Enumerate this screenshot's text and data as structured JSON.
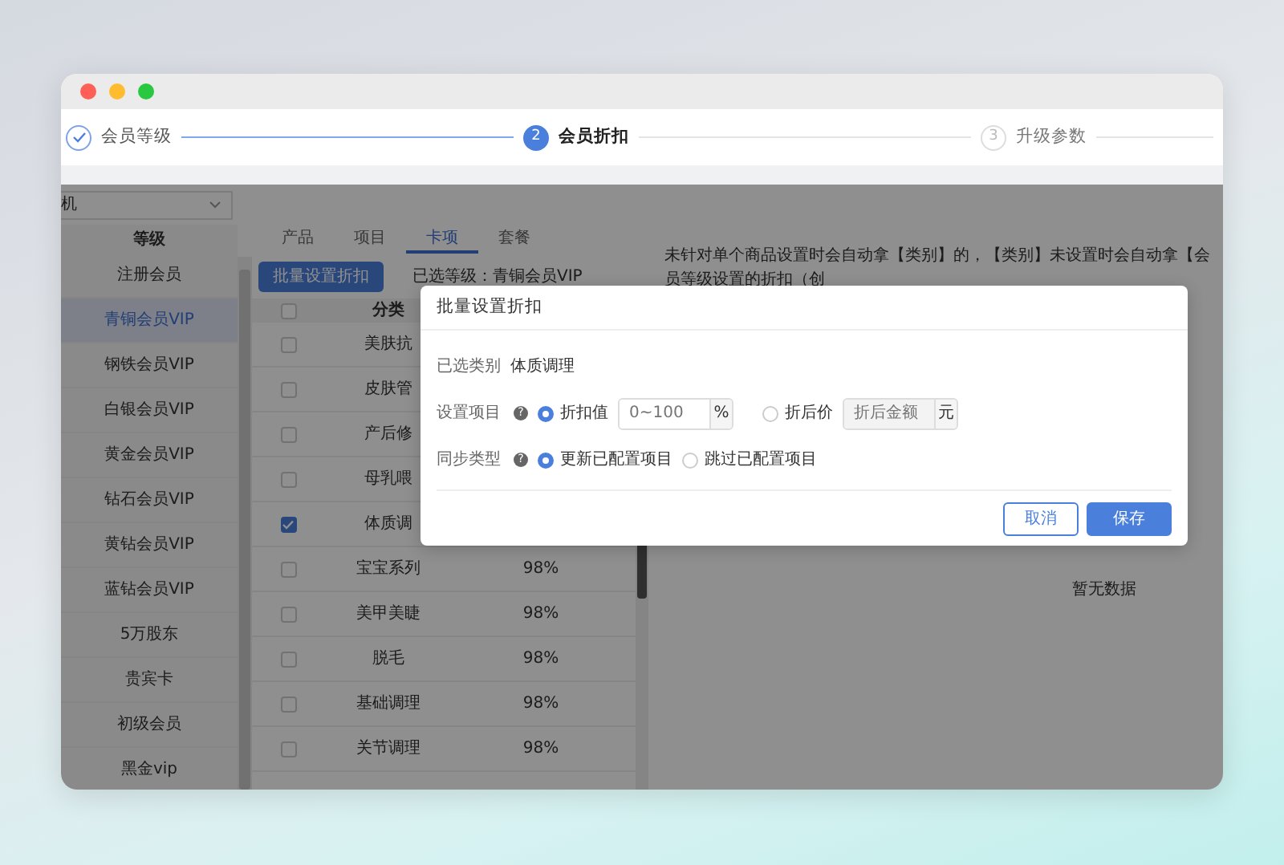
{
  "steps": [
    {
      "label": "会员等级",
      "completed": true,
      "selected": false
    },
    {
      "number": "2",
      "label": "会员折扣",
      "completed": false,
      "selected": true
    },
    {
      "number": "3",
      "label": "升级参数",
      "completed": false,
      "selected": false
    }
  ],
  "level_filter": {
    "value": "机"
  },
  "levels": {
    "header": "等级",
    "items": [
      {
        "label": "注册会员",
        "selected": false
      },
      {
        "label": "青铜会员VIP",
        "selected": true
      },
      {
        "label": "钢铁会员VIP",
        "selected": false
      },
      {
        "label": "白银会员VIP",
        "selected": false
      },
      {
        "label": "黄金会员VIP",
        "selected": false
      },
      {
        "label": "钻石会员VIP",
        "selected": false
      },
      {
        "label": "黄钻会员VIP",
        "selected": false
      },
      {
        "label": "蓝钻会员VIP",
        "selected": false
      },
      {
        "label": "5万股东",
        "selected": false
      },
      {
        "label": "贵宾卡",
        "selected": false
      },
      {
        "label": "初级会员",
        "selected": false
      },
      {
        "label": "黑金vip",
        "selected": false
      }
    ]
  },
  "tabs": [
    {
      "label": "产品",
      "selected": false
    },
    {
      "label": "项目",
      "selected": false
    },
    {
      "label": "卡项",
      "selected": true
    },
    {
      "label": "套餐",
      "selected": false
    }
  ],
  "batch_button": "批量设置折扣",
  "selected_level": "已选等级：青铜会员VIP",
  "table": {
    "header_checked": false,
    "columns": [
      "分类"
    ],
    "rows": [
      {
        "checked": false,
        "category": "美肤抗"
      },
      {
        "checked": false,
        "category": "皮肤管"
      },
      {
        "checked": false,
        "category": "产后修"
      },
      {
        "checked": false,
        "category": "母乳喂"
      },
      {
        "checked": true,
        "category": "体质调"
      },
      {
        "checked": false,
        "category": "宝宝系列",
        "discount": "98%"
      },
      {
        "checked": false,
        "category": "美甲美睫",
        "discount": "98%"
      },
      {
        "checked": false,
        "category": "脱毛",
        "discount": "98%"
      },
      {
        "checked": false,
        "category": "基础调理",
        "discount": "98%"
      },
      {
        "checked": false,
        "category": "关节调理",
        "discount": "98%"
      }
    ]
  },
  "notice": "未针对单个商品设置时会自动拿【类别】的，【类别】未设置时会自动拿【会员等级设置的折扣（创",
  "empty_text": "暂无数据",
  "dialog": {
    "title": "批量设置折扣",
    "selected_category": {
      "label": "已选类别",
      "value": "体质调理"
    },
    "set_item": {
      "label": "设置项目",
      "help": "?",
      "options": [
        {
          "label": "折扣值",
          "selected": true,
          "placeholder": "0~100",
          "unit": "%",
          "disabled": false
        },
        {
          "label": "折后价",
          "selected": false,
          "placeholder": "折后金额",
          "unit": "元",
          "disabled": true
        }
      ]
    },
    "sync_type": {
      "label": "同步类型",
      "help": "?",
      "options": [
        {
          "label": "更新已配置项目",
          "selected": true
        },
        {
          "label": "跳过已配置项目",
          "selected": false
        }
      ]
    },
    "buttons": [
      {
        "label": "取消",
        "kind": "secondary"
      },
      {
        "label": "保存",
        "kind": "primary"
      }
    ]
  }
}
